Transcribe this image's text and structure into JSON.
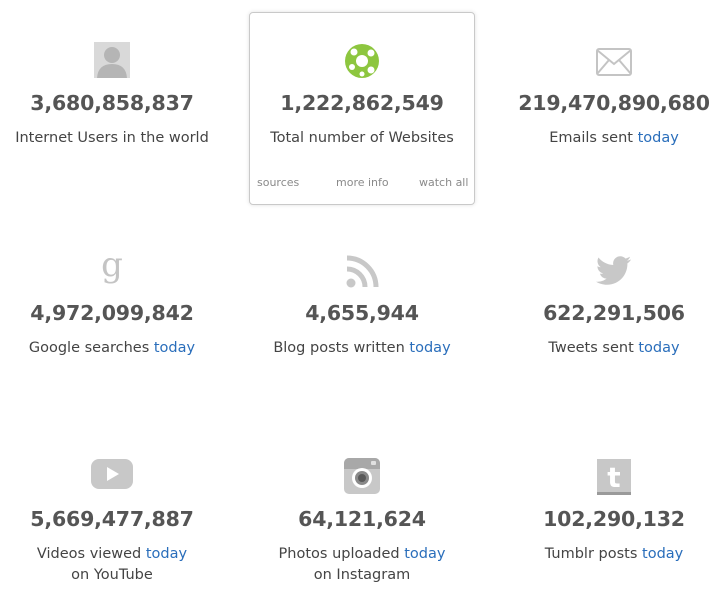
{
  "stats": [
    {
      "number": "3,680,858,837",
      "label": "Internet Users in the world",
      "today": "",
      "line2": ""
    },
    {
      "number": "1,222,862,549",
      "label": "Total number of Websites",
      "today": "",
      "line2": ""
    },
    {
      "number": "219,470,890,680",
      "label": "Emails sent",
      "today": "today",
      "line2": ""
    },
    {
      "number": "4,972,099,842",
      "label": "Google searches",
      "today": "today",
      "line2": ""
    },
    {
      "number": "4,655,944",
      "label": "Blog posts written",
      "today": "today",
      "line2": ""
    },
    {
      "number": "622,291,506",
      "label": "Tweets sent",
      "today": "today",
      "line2": ""
    },
    {
      "number": "5,669,477,887",
      "label": "Videos viewed",
      "today": "today",
      "line2": "on YouTube"
    },
    {
      "number": "64,121,624",
      "label": "Photos uploaded",
      "today": "today",
      "line2": "on Instagram"
    },
    {
      "number": "102,290,132",
      "label": "Tumblr posts",
      "today": "today",
      "line2": ""
    }
  ],
  "card_links": {
    "sources": "sources",
    "more_info": "more info",
    "watch_all": "watch all"
  },
  "icons": [
    "user-icon",
    "website-icon",
    "email-icon",
    "google-icon",
    "rss-icon",
    "twitter-icon",
    "youtube-icon",
    "instagram-icon",
    "tumblr-icon"
  ],
  "colors": {
    "number": "#555555",
    "label": "#444444",
    "today_link": "#2a6ebb",
    "icon": "#c8c8c8",
    "website_icon": "#8dc63f"
  }
}
